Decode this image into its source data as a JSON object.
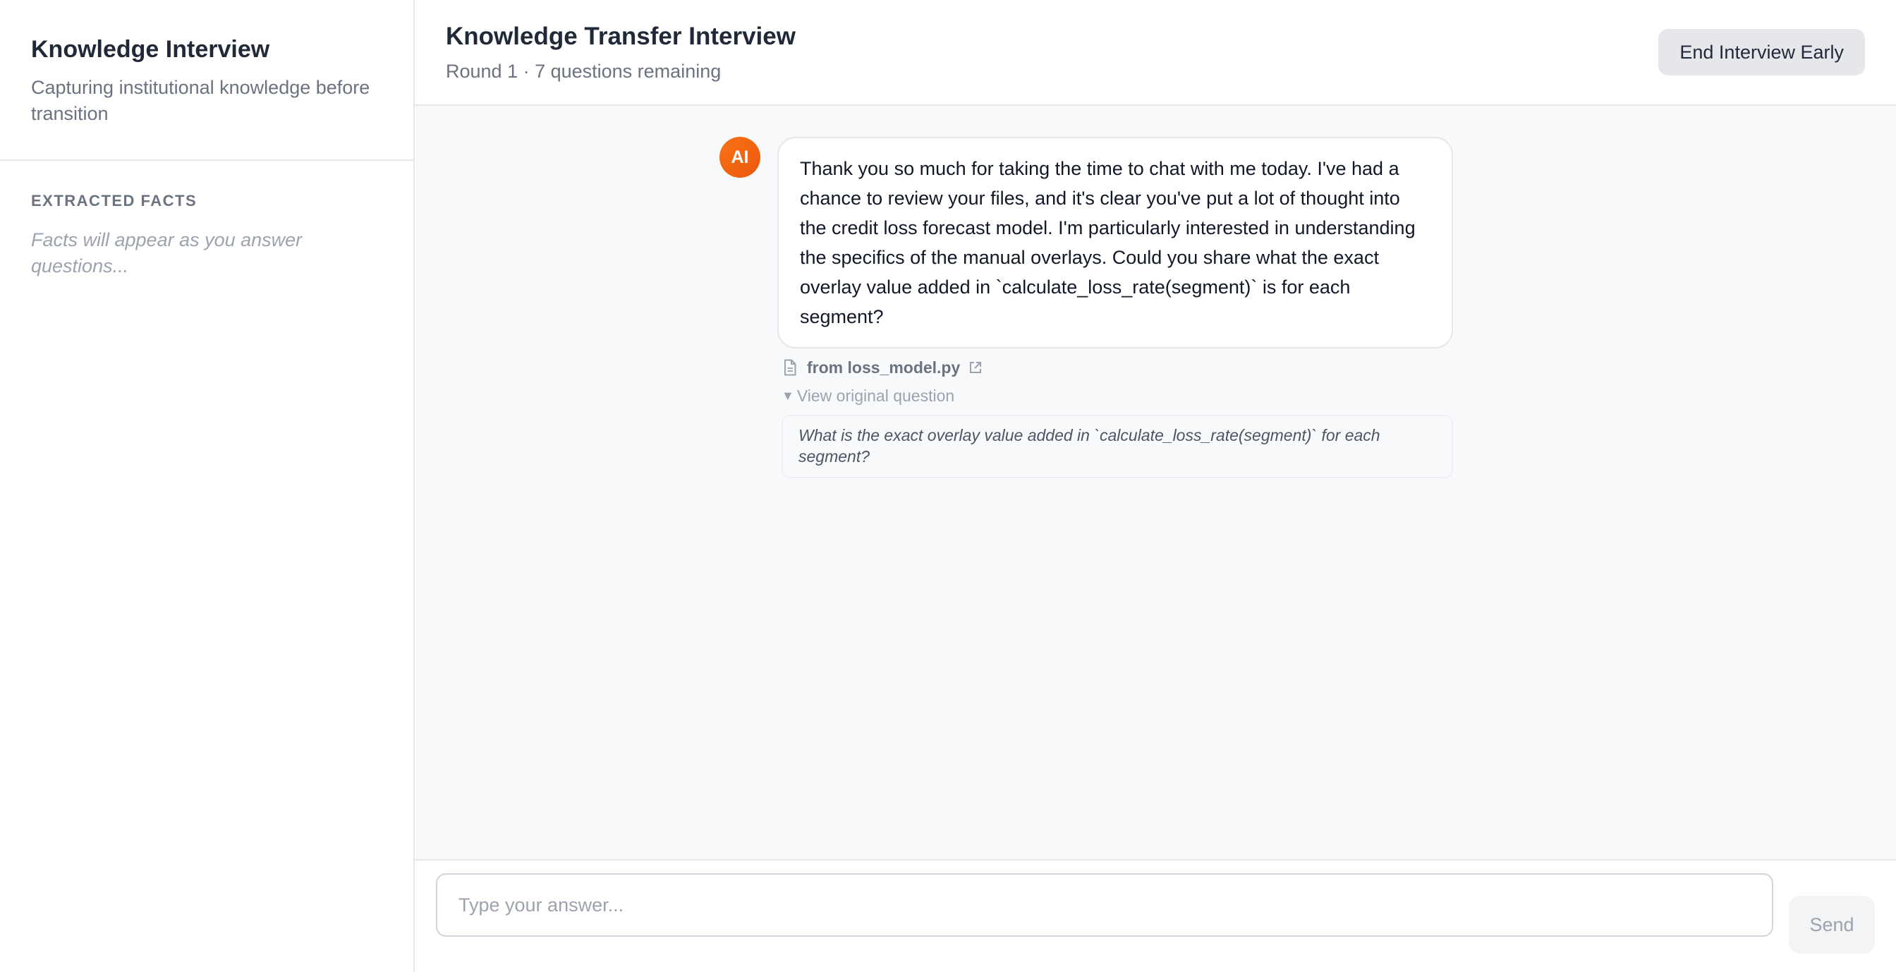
{
  "sidebar": {
    "title": "Knowledge Interview",
    "subtitle": "Capturing institutional knowledge before transition",
    "facts_heading": "EXTRACTED FACTS",
    "facts_empty": "Facts will appear as you answer questions..."
  },
  "header": {
    "title": "Knowledge Transfer Interview",
    "subtitle": "Round 1 · 7 questions remaining",
    "end_button": "End Interview Early"
  },
  "messages": [
    {
      "avatar": "AI",
      "text": "Thank you so much for taking the time to chat with me today. I've had a chance to review your files, and it's clear you've put a lot of thought into the credit loss forecast model. I'm particularly interested in understanding the specifics of the manual overlays. Could you share what the exact overlay value added in `calculate_loss_rate(segment)` is for each segment?",
      "source": "from loss_model.py",
      "toggle_label": "View original question",
      "original_question": "What is the exact overlay value added in `calculate_loss_rate(segment)` for each segment?"
    }
  ],
  "composer": {
    "placeholder": "Type your answer...",
    "value": "",
    "send_label": "Send"
  },
  "colors": {
    "accent": "#f97316",
    "border": "#e5e7eb",
    "chat_bg": "#f8f9fb"
  },
  "icons": [
    "file-icon",
    "external-link-icon",
    "caret-down-icon"
  ]
}
